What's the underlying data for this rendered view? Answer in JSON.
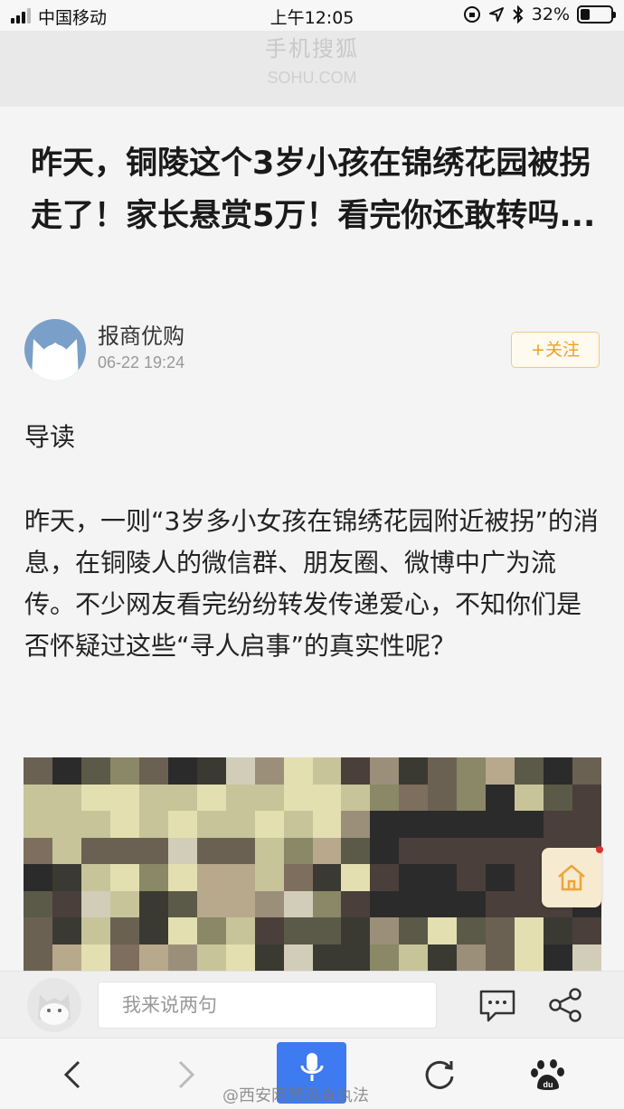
{
  "status_bar": {
    "carrier": "中国移动",
    "time": "上午12:05",
    "battery_percent_label": "32%",
    "battery_level": 0.32
  },
  "site": {
    "name_cn": "手机搜狐",
    "name_en": "SOHU.COM"
  },
  "article": {
    "title": "昨天，铜陵这个3岁小孩在锦绣花园被拐走了！家长悬赏5万！看完你还敢转吗...",
    "author": "报商优购",
    "date": "06-22 19:24",
    "follow_label": "+关注",
    "lead_heading": "导读",
    "paragraph": "昨天，一则“3岁多小女孩在锦绣花园附近被拐”的消息，在铜陵人的微信群、朋友圈、微博中广为流传。不少网友看完纷纷转发传递爱心，不知你们是否怀疑过这些“寻人启事”的真实性呢？"
  },
  "comment_bar": {
    "placeholder": "我来说两句"
  },
  "watermark": "@西安网警巡查执法",
  "icons": {
    "home": "home-icon",
    "comment": "comment-icon",
    "share": "share-icon",
    "back": "chevron-left-icon",
    "forward": "chevron-right-icon",
    "mic": "microphone-icon",
    "refresh": "refresh-icon",
    "baidu": "baidu-paw-icon"
  },
  "colors": {
    "follow_accent": "#f0a020",
    "mic_button": "#3e7bf0",
    "notification_dot": "#e0302e"
  }
}
